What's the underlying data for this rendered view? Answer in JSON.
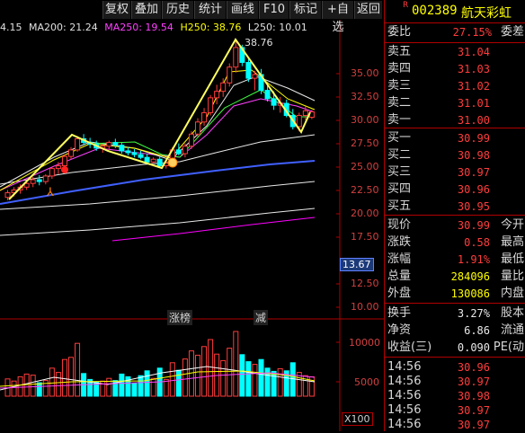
{
  "toolbar": {
    "buttons": [
      "复权",
      "叠加",
      "历史",
      "统计",
      "画线",
      "F10",
      "标记",
      "+自选",
      "返回"
    ]
  },
  "legend": {
    "ma_partial": "4.15",
    "ma200": "MA200: 21.24",
    "ma250": "MA250: 19.54",
    "h250": "H250: 38.76",
    "l250": "L250: 10.01"
  },
  "price_axis": [
    "35.00",
    "32.50",
    "30.00",
    "27.50",
    "25.00",
    "22.50",
    "20.00",
    "17.50",
    "13.67",
    "12.50",
    "10.00"
  ],
  "peak_label": "38.76",
  "chips": [
    "涨榜",
    "减"
  ],
  "volume_axis": [
    "10000",
    "5000"
  ],
  "volume_unit": "X100",
  "stock": {
    "badge": "R",
    "code": "002389",
    "name": "航天彩虹"
  },
  "order_book": {
    "ratio_label": "委比",
    "ratio_value": "27.15%",
    "ratio_extra": "委差",
    "sells": [
      {
        "label": "卖五",
        "price": "31.04"
      },
      {
        "label": "卖四",
        "price": "31.03"
      },
      {
        "label": "卖三",
        "price": "31.02"
      },
      {
        "label": "卖二",
        "price": "31.01"
      },
      {
        "label": "卖一",
        "price": "31.00"
      }
    ],
    "buys": [
      {
        "label": "买一",
        "price": "30.99"
      },
      {
        "label": "买二",
        "price": "30.98"
      },
      {
        "label": "买三",
        "price": "30.97"
      },
      {
        "label": "买四",
        "price": "30.96"
      },
      {
        "label": "买五",
        "price": "30.95"
      }
    ]
  },
  "quote": [
    {
      "label": "现价",
      "value": "30.99",
      "extra": "今开"
    },
    {
      "label": "涨跌",
      "value": "0.58",
      "extra": "最高"
    },
    {
      "label": "涨幅",
      "value": "1.91%",
      "extra": "最低"
    },
    {
      "label": "总量",
      "value": "284096",
      "extra": "量比"
    },
    {
      "label": "外盘",
      "value": "130086",
      "extra": "内盘"
    }
  ],
  "fundamentals": [
    {
      "label": "换手",
      "value": "3.27%",
      "extra": "股本"
    },
    {
      "label": "净资",
      "value": "6.86",
      "extra": "流通"
    },
    {
      "label": "收益(三)",
      "value": "0.090",
      "extra": "PE(动"
    }
  ],
  "ticks": [
    {
      "time": "14:56",
      "price": "30.96"
    },
    {
      "time": "14:56",
      "price": "30.97"
    },
    {
      "time": "14:56",
      "price": "30.98"
    },
    {
      "time": "14:56",
      "price": "30.97"
    },
    {
      "time": "14:56",
      "price": "30.97"
    }
  ],
  "colors": {
    "up": "#ff3c3c",
    "down": "#00ffff",
    "ma_short": "#ffffff",
    "ma_mid": "#ffff00",
    "ma200": "#4060ff",
    "ma250": "#ff00ff"
  },
  "price_chart": {
    "type": "candlestick",
    "ylim": [
      10.0,
      38.76
    ],
    "ohlc": [
      [
        21.8,
        22.6,
        21.5,
        22.3
      ],
      [
        22.3,
        22.9,
        21.9,
        22.6
      ],
      [
        22.6,
        23.2,
        22.2,
        22.9
      ],
      [
        22.9,
        23.6,
        22.6,
        23.3
      ],
      [
        23.3,
        24.0,
        22.9,
        23.7
      ],
      [
        23.7,
        24.2,
        23.1,
        23.5
      ],
      [
        23.5,
        24.3,
        23.2,
        24.1
      ],
      [
        24.1,
        25.1,
        23.8,
        24.9
      ],
      [
        24.9,
        25.6,
        24.3,
        25.2
      ],
      [
        25.2,
        26.4,
        24.9,
        26.2
      ],
      [
        26.2,
        27.2,
        25.9,
        26.9
      ],
      [
        26.9,
        28.4,
        26.7,
        28.1
      ],
      [
        28.1,
        28.6,
        27.4,
        27.7
      ],
      [
        27.7,
        28.2,
        27.1,
        27.5
      ],
      [
        27.5,
        27.9,
        26.8,
        27.1
      ],
      [
        27.1,
        27.5,
        26.6,
        27.3
      ],
      [
        27.3,
        27.9,
        26.9,
        27.7
      ],
      [
        27.7,
        28.1,
        27.1,
        27.4
      ],
      [
        27.4,
        27.7,
        26.5,
        26.8
      ],
      [
        26.8,
        27.2,
        26.3,
        26.6
      ],
      [
        26.6,
        27.0,
        26.1,
        26.4
      ],
      [
        26.4,
        26.8,
        25.9,
        26.1
      ],
      [
        26.1,
        26.5,
        25.4,
        25.6
      ],
      [
        25.6,
        26.1,
        25.2,
        25.9
      ],
      [
        25.9,
        26.3,
        25.0,
        25.2
      ],
      [
        25.2,
        25.8,
        24.9,
        25.5
      ],
      [
        25.5,
        27.2,
        25.2,
        26.9
      ],
      [
        26.9,
        27.6,
        26.3,
        26.5
      ],
      [
        26.5,
        27.6,
        26.1,
        27.3
      ],
      [
        27.3,
        28.9,
        27.0,
        28.6
      ],
      [
        28.6,
        30.3,
        28.3,
        29.9
      ],
      [
        29.9,
        31.4,
        29.5,
        30.9
      ],
      [
        30.9,
        32.8,
        30.6,
        32.5
      ],
      [
        32.5,
        33.9,
        31.8,
        33.2
      ],
      [
        33.2,
        34.6,
        32.6,
        34.1
      ],
      [
        34.1,
        36.2,
        33.7,
        35.8
      ],
      [
        35.8,
        38.76,
        35.2,
        37.9
      ],
      [
        37.9,
        38.2,
        35.9,
        36.3
      ],
      [
        36.3,
        36.8,
        34.2,
        34.6
      ],
      [
        34.6,
        35.4,
        33.3,
        35.0
      ],
      [
        35.0,
        35.6,
        32.9,
        33.3
      ],
      [
        33.3,
        34.1,
        32.1,
        32.4
      ],
      [
        32.4,
        33.2,
        31.2,
        31.7
      ],
      [
        31.7,
        32.6,
        30.9,
        31.9
      ],
      [
        31.9,
        32.3,
        30.4,
        30.6
      ],
      [
        30.6,
        31.3,
        29.1,
        29.4
      ],
      [
        29.4,
        30.9,
        28.9,
        30.6
      ],
      [
        30.6,
        31.6,
        30.1,
        31.1
      ],
      [
        30.41,
        31.2,
        30.2,
        30.99
      ]
    ],
    "volume": [
      3200,
      2800,
      3600,
      4100,
      3900,
      2500,
      2900,
      5200,
      4400,
      6800,
      7200,
      9800,
      4200,
      3100,
      2600,
      2800,
      3300,
      2900,
      4100,
      3600,
      2400,
      3800,
      4700,
      3300,
      5200,
      3100,
      6200,
      4800,
      6900,
      8400,
      7600,
      9200,
      10500,
      7800,
      6600,
      8900,
      12000,
      7700,
      6400,
      5900,
      6800,
      5200,
      4600,
      5100,
      4700,
      6200,
      4400,
      3800,
      3600
    ]
  }
}
